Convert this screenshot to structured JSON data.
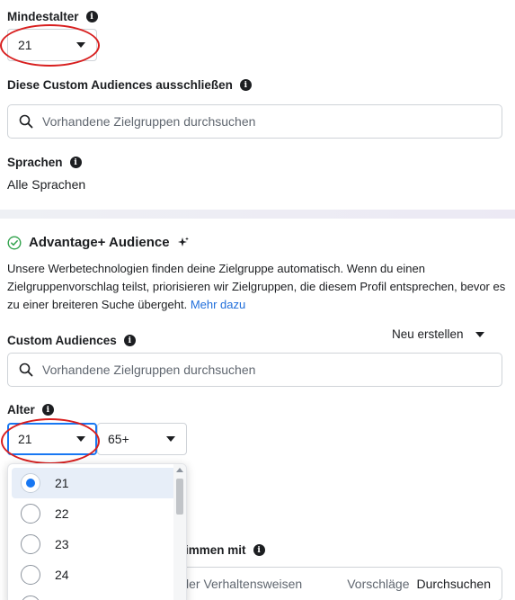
{
  "min_age": {
    "label": "Mindestalter",
    "value": "21"
  },
  "exclude_audiences": {
    "label": "Diese Custom Audiences ausschließen",
    "search_placeholder": "Vorhandene Zielgruppen durchsuchen"
  },
  "languages": {
    "label": "Sprachen",
    "value": "Alle Sprachen"
  },
  "advantage": {
    "title": "Advantage+ Audience",
    "description": "Unsere Werbetechnologien finden deine Zielgruppe automatisch. Wenn du einen Zielgruppenvorschlag teilst, priorisieren wir Zielgruppen, die diesem Profil entsprechen, bevor es zu einer breiteren Suche übergeht.",
    "link": "Mehr dazu"
  },
  "custom_audiences": {
    "label": "Custom Audiences",
    "new_button": "Neu erstellen",
    "search_placeholder": "Vorhandene Zielgruppen durchsuchen"
  },
  "age": {
    "label": "Alter",
    "from": "21",
    "to": "65+",
    "options": [
      {
        "label": "21",
        "selected": true
      },
      {
        "label": "22",
        "selected": false
      },
      {
        "label": "23",
        "selected": false
      },
      {
        "label": "24",
        "selected": false
      }
    ]
  },
  "detailed_targeting": {
    "label_partial": "immen mit",
    "placeholder_partial": "ler Verhaltensweisen",
    "suggestions": "Vorschläge",
    "browse": "Durchsuchen"
  },
  "colors": {
    "accent": "#1877f2",
    "highlight_ring": "#d81e1e",
    "link": "#216fdb"
  }
}
